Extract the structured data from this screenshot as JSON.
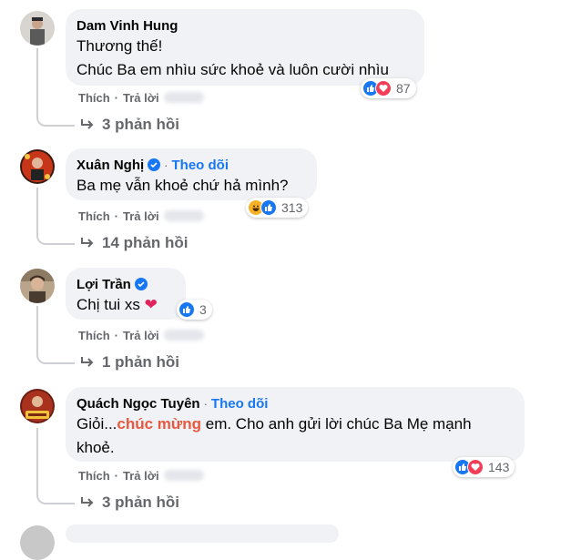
{
  "comments": [
    {
      "author": "Dam Vinh Hung",
      "verified": false,
      "follow": "",
      "lines": [
        "Thương thế!",
        "Chúc Ba em nhìu sức khoẻ và luôn cười nhìu"
      ],
      "like_label": "Thích",
      "reply_label": "Trả lời",
      "reaction_count": "87",
      "reaction_icons": [
        "like-icon",
        "love-icon"
      ],
      "replies_label": "3 phản hồi"
    },
    {
      "author": "Xuân Nghị",
      "verified": true,
      "follow": "Theo dõi",
      "lines": [
        "Ba mẹ vẫn khoẻ chứ hả mình?"
      ],
      "like_label": "Thích",
      "reply_label": "Trả lời",
      "reaction_count": "313",
      "reaction_icons": [
        "haha-icon",
        "like-icon"
      ],
      "replies_label": "14 phản hồi"
    },
    {
      "author": "Lợi Trần",
      "verified": true,
      "follow": "",
      "text_prefix": "Chị tui xs",
      "like_label": "Thích",
      "reply_label": "Trả lời",
      "reaction_count": "3",
      "reaction_icons": [
        "like-icon"
      ],
      "replies_label": "1 phản hồi"
    },
    {
      "author": "Quách Ngọc Tuyên",
      "verified": false,
      "follow": "Theo dõi",
      "text_part1": "Giỏi...",
      "text_highlight": "chúc mừng",
      "text_part2": " em. Cho anh gửi lời chúc Ba Mẹ mạnh",
      "text_line2": "khoẻ.",
      "like_label": "Thích",
      "reply_label": "Trả lời",
      "reaction_count": "143",
      "reaction_icons": [
        "like-icon",
        "love-icon"
      ],
      "replies_label": "3 phản hồi"
    }
  ],
  "separator": "·",
  "colors": {
    "bubble": "#f0f2f5",
    "secondary_text": "#65676b",
    "link_blue": "#1877f2",
    "highlight": "#e8583f"
  }
}
